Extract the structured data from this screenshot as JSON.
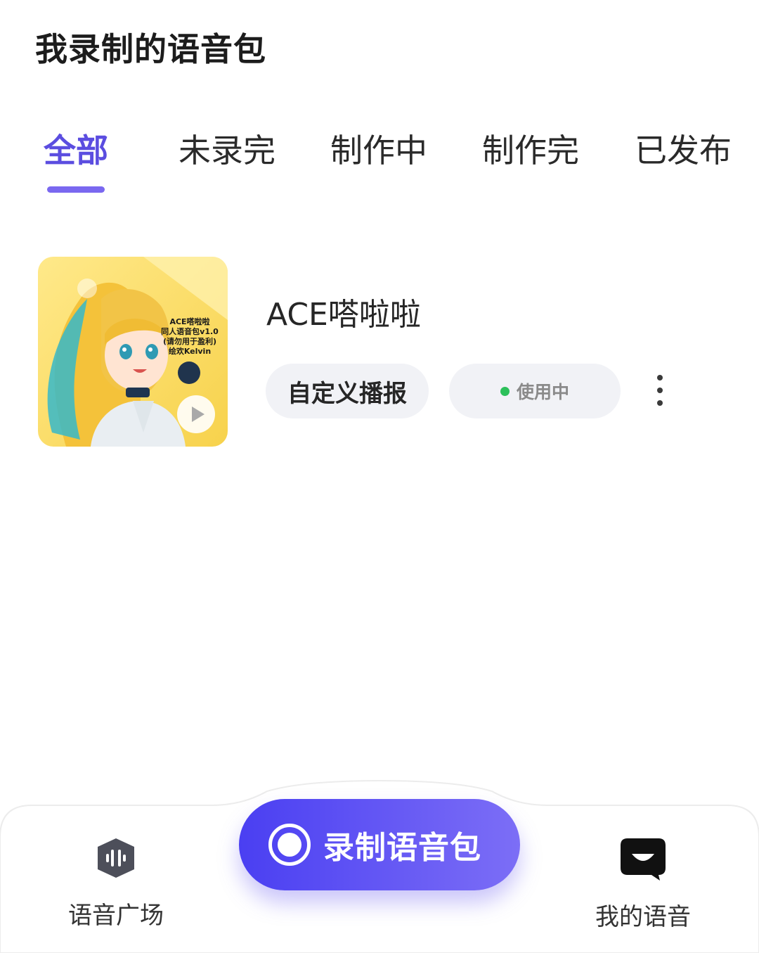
{
  "header": {
    "title": "我录制的语音包"
  },
  "tabs": [
    {
      "label": "全部",
      "active": true
    },
    {
      "label": "未录完",
      "active": false
    },
    {
      "label": "制作中",
      "active": false
    },
    {
      "label": "制作完",
      "active": false
    },
    {
      "label": "已发布",
      "active": false
    }
  ],
  "pack": {
    "name": "ACE嗒啦啦",
    "cover_text": "ACE嗒啦啦\n同人语音包v1.0\n(请勿用于盈利)\n绘欢Kelvin",
    "custom_button": "自定义播报",
    "status": "使用中"
  },
  "bottom_nav": {
    "plaza": "语音广场",
    "record": "录制语音包",
    "mine": "我的语音"
  },
  "colors": {
    "accent": "#5b4de0",
    "status_dot": "#2cc05a",
    "record_gradient_start": "#4a3ff2",
    "record_gradient_end": "#7c6ef6"
  }
}
